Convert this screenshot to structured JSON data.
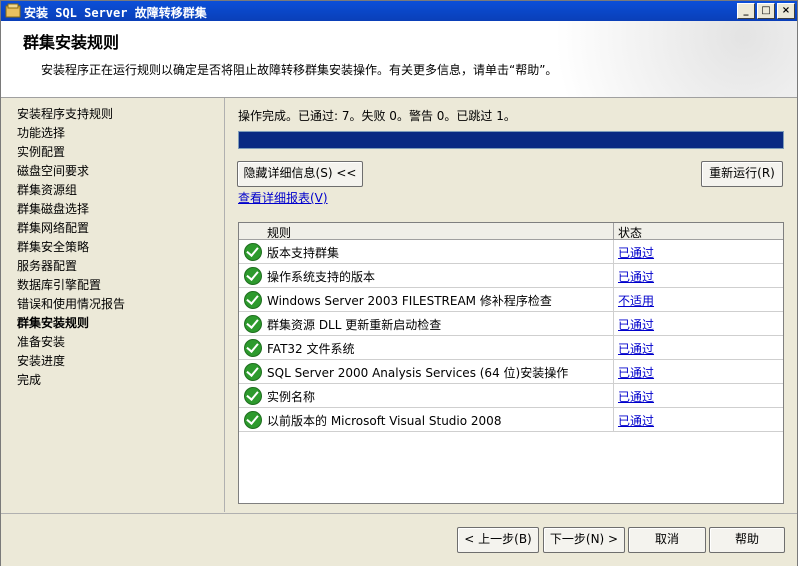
{
  "window": {
    "title": "安装 SQL Server 故障转移群集",
    "buttons": [
      "_",
      "□",
      "×"
    ]
  },
  "header": {
    "title": "群集安装规则",
    "description": "安装程序正在运行规则以确定是否将阻止故障转移群集安装操作。有关更多信息，请单击“帮助”。"
  },
  "sidebar": {
    "items": [
      "安装程序支持规则",
      "功能选择",
      "实例配置",
      "磁盘空间要求",
      "群集资源组",
      "群集磁盘选择",
      "群集网络配置",
      "群集安全策略",
      "服务器配置",
      "数据库引擎配置",
      "错误和使用情况报告",
      "群集安装规则",
      "准备安装",
      "安装进度",
      "完成"
    ],
    "active_index": 11
  },
  "main": {
    "status": "操作完成。已通过: 7。失败 0。警告 0。已跳过 1。",
    "progress": 1.0,
    "hide_details_label": "隐藏详细信息(S) <<",
    "rerun_label": "重新运行(R)",
    "view_report_link": "查看详细报表(V)",
    "table": {
      "headers": [
        "规则",
        "状态"
      ],
      "rows": [
        {
          "rule": "版本支持群集",
          "status": "已通过"
        },
        {
          "rule": "操作系统支持的版本",
          "status": "已通过"
        },
        {
          "rule": "Windows Server 2003 FILESTREAM 修补程序检查",
          "status": "不适用"
        },
        {
          "rule": "群集资源 DLL 更新重新启动检查",
          "status": "已通过"
        },
        {
          "rule": "FAT32 文件系统",
          "status": "已通过"
        },
        {
          "rule": "SQL Server 2000 Analysis Services (64 位)安装操作",
          "status": "已通过"
        },
        {
          "rule": "实例名称",
          "status": "已通过"
        },
        {
          "rule": "以前版本的 Microsoft Visual Studio 2008",
          "status": "已通过"
        }
      ]
    }
  },
  "footer": {
    "back_label": "< 上一步(B)",
    "next_label": "下一步(N) >",
    "cancel_label": "取消",
    "help_label": "帮助"
  },
  "colors": {
    "titlebar": "#0a3fb8",
    "progress": "#0a2a82",
    "link": "#0000cc",
    "ok": "#2d9a2d"
  }
}
